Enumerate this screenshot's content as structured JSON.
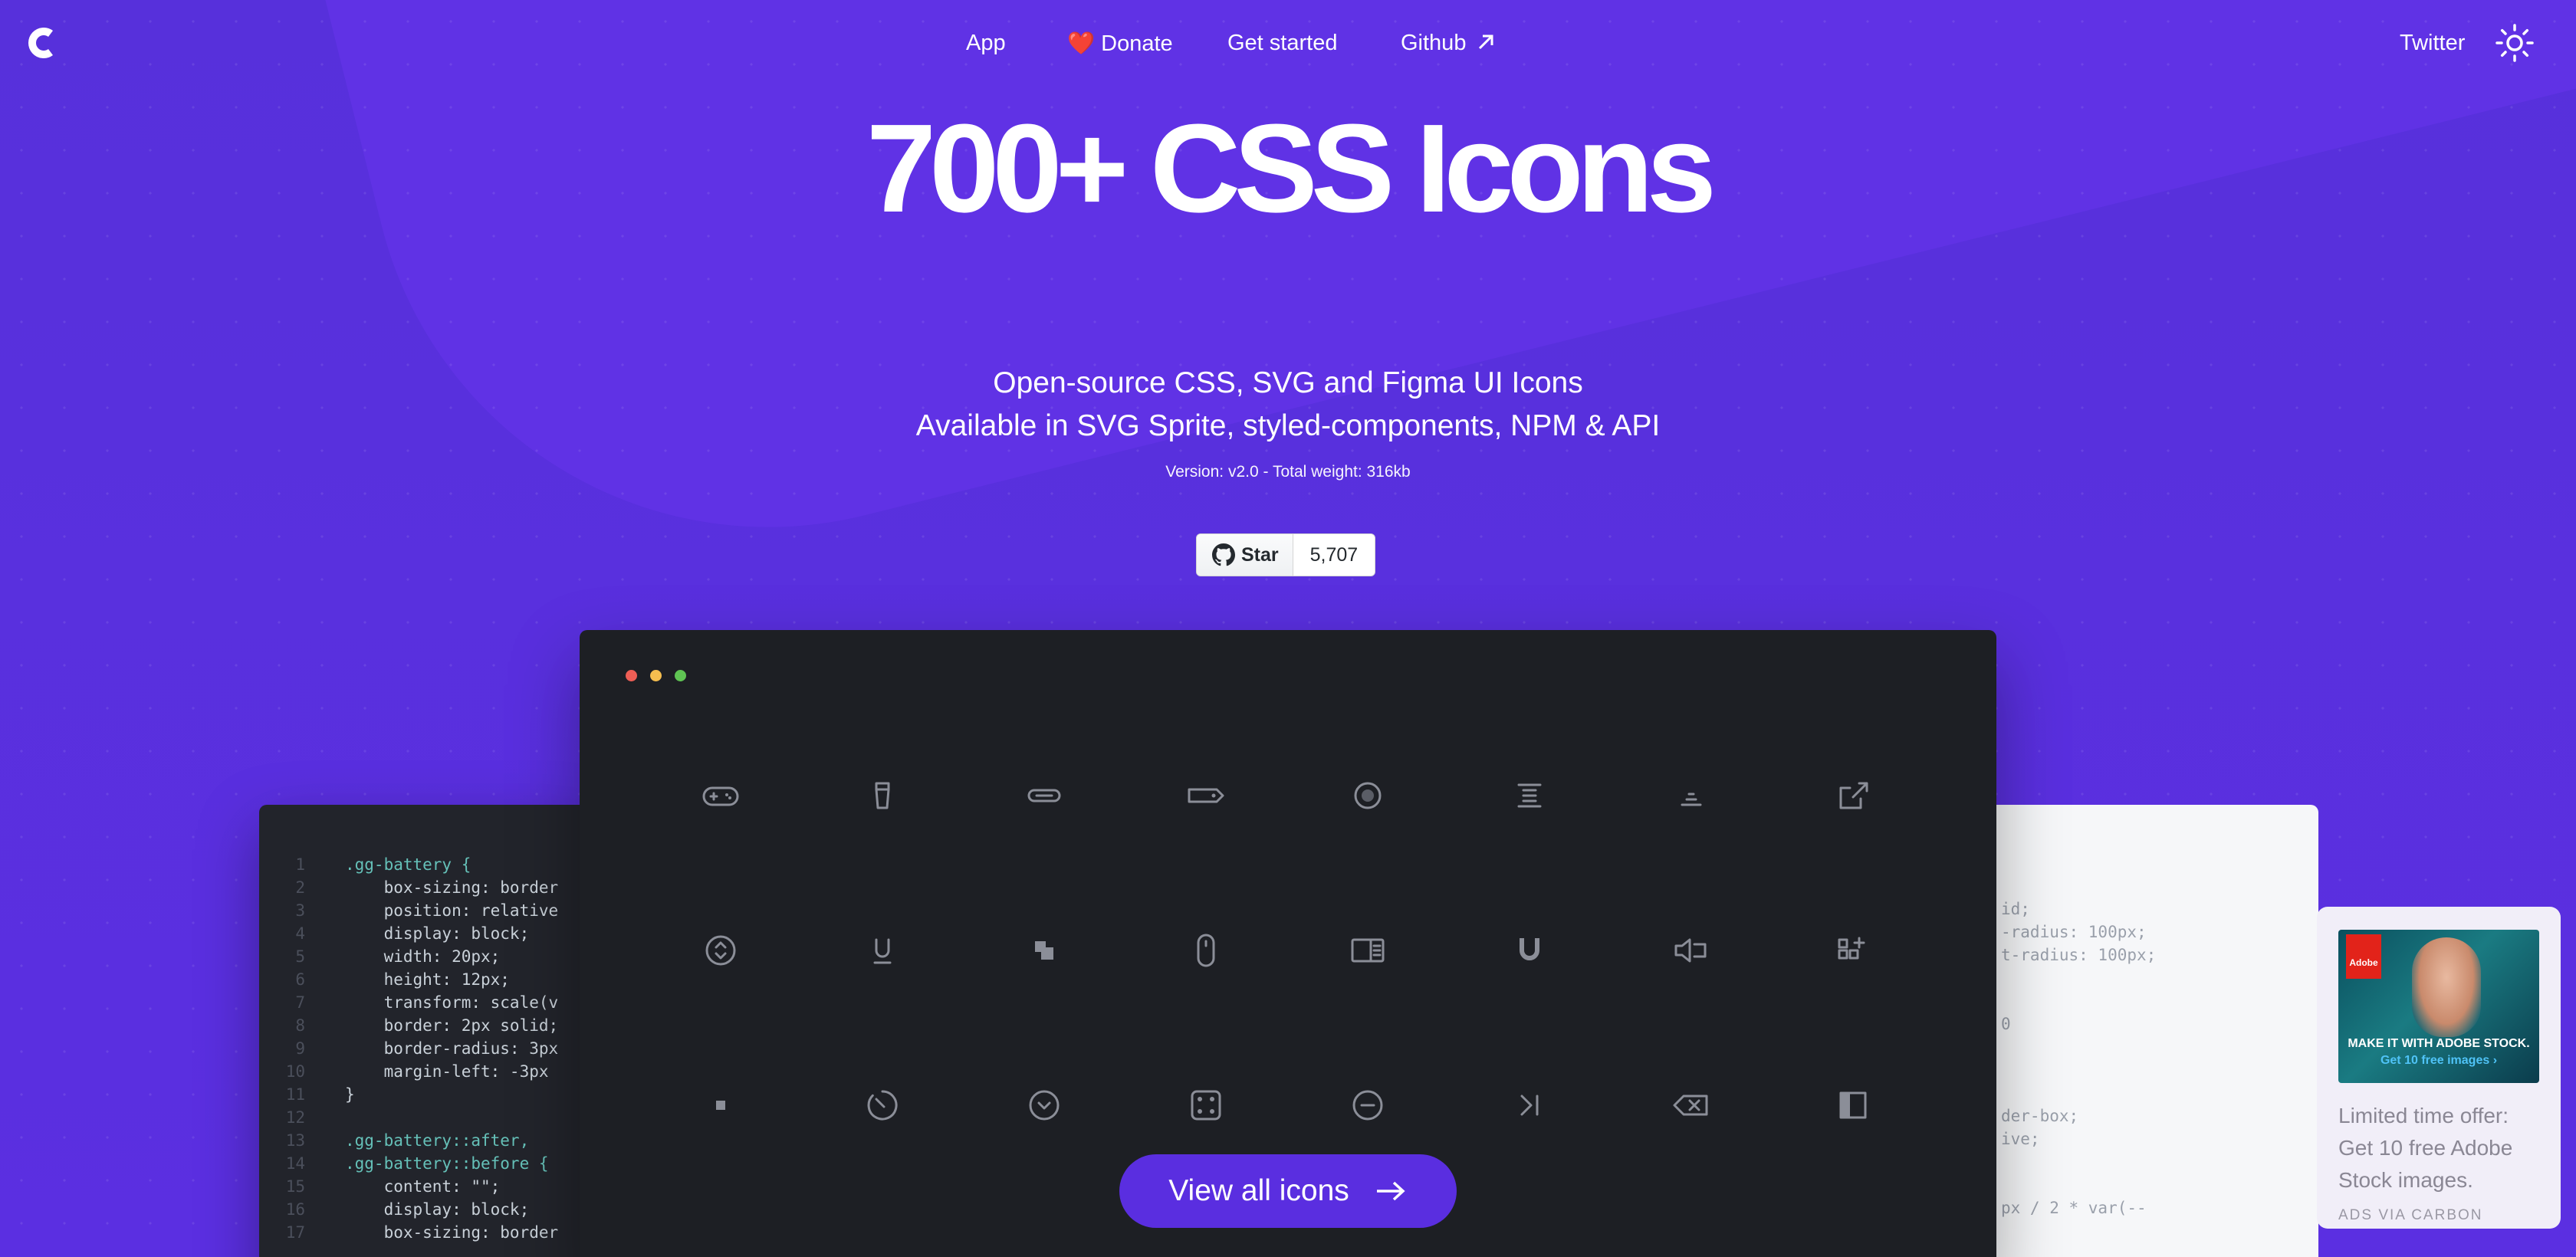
{
  "nav": {
    "app": "App",
    "donate": "Donate",
    "get_started": "Get started",
    "github": "Github",
    "twitter": "Twitter"
  },
  "hero": {
    "title": "700+ CSS Icons",
    "subtitle_line1": "Open-source CSS, SVG and Figma UI Icons",
    "subtitle_line2": "Available in SVG Sprite, styled-components, NPM & API",
    "version": "Version: v2.0 - Total weight: 316kb"
  },
  "github_star": {
    "label": "Star",
    "count": "5,707"
  },
  "icons_grid": [
    [
      "gamepad-icon",
      "battery-icon",
      "link-pill-icon",
      "tag-icon",
      "asterisk-circle-icon",
      "align-justify-icon",
      "align-bottom-icon",
      "external-link-icon"
    ],
    [
      "arrows-v-circle-icon",
      "magnet-u-icon",
      "squares-overlap-icon",
      "mouse-icon",
      "sidebar-right-icon",
      "magnet-icon",
      "speaker-left-icon",
      "add-grid-icon"
    ],
    [
      "stop-icon",
      "timer-icon",
      "chevron-down-circle-icon",
      "dice-four-icon",
      "minus-circle-icon",
      "play-track-next-icon",
      "backspace-icon",
      "sidebar-left-icon"
    ]
  ],
  "view_all": "View all icons",
  "code_left": [
    [
      ".gg-battery {",
      "sel"
    ],
    [
      "    box-sizing: border",
      ""
    ],
    [
      "    position: relative",
      ""
    ],
    [
      "    display: block;",
      ""
    ],
    [
      "    width: 20px;",
      ""
    ],
    [
      "    height: 12px;",
      ""
    ],
    [
      "    transform: scale(v",
      ""
    ],
    [
      "    border: 2px solid;",
      ""
    ],
    [
      "    border-radius: 3px",
      ""
    ],
    [
      "    margin-left: -3px",
      ""
    ],
    [
      "}",
      ""
    ],
    [
      "",
      ""
    ],
    [
      ".gg-battery::after,",
      "sel"
    ],
    [
      ".gg-battery::before {",
      "sel"
    ],
    [
      "    content: \"\";",
      ""
    ],
    [
      "    display: block;",
      ""
    ],
    [
      "    box-sizing: border",
      ""
    ]
  ],
  "code_right": [
    "id;",
    "-radius: 100px;",
    "t-radius: 100px;",
    "",
    "",
    "0",
    "",
    "",
    "",
    "der-box;",
    "ive;",
    "",
    "",
    "px / 2 * var(--"
  ],
  "ad": {
    "brand": "Adobe",
    "headline": "MAKE IT WITH ADOBE STOCK.",
    "cta": "Get 10 free images ›",
    "text": "Limited time offer: Get 10 free Adobe Stock images.",
    "via": "ADS VIA CARBON"
  },
  "colors": {
    "background": "#5a2ee0",
    "window": "#1d1f24",
    "button": "#5a2ee0",
    "dot_red": "#ee5e55",
    "dot_yellow": "#f6be4f",
    "dot_green": "#5fc453"
  }
}
